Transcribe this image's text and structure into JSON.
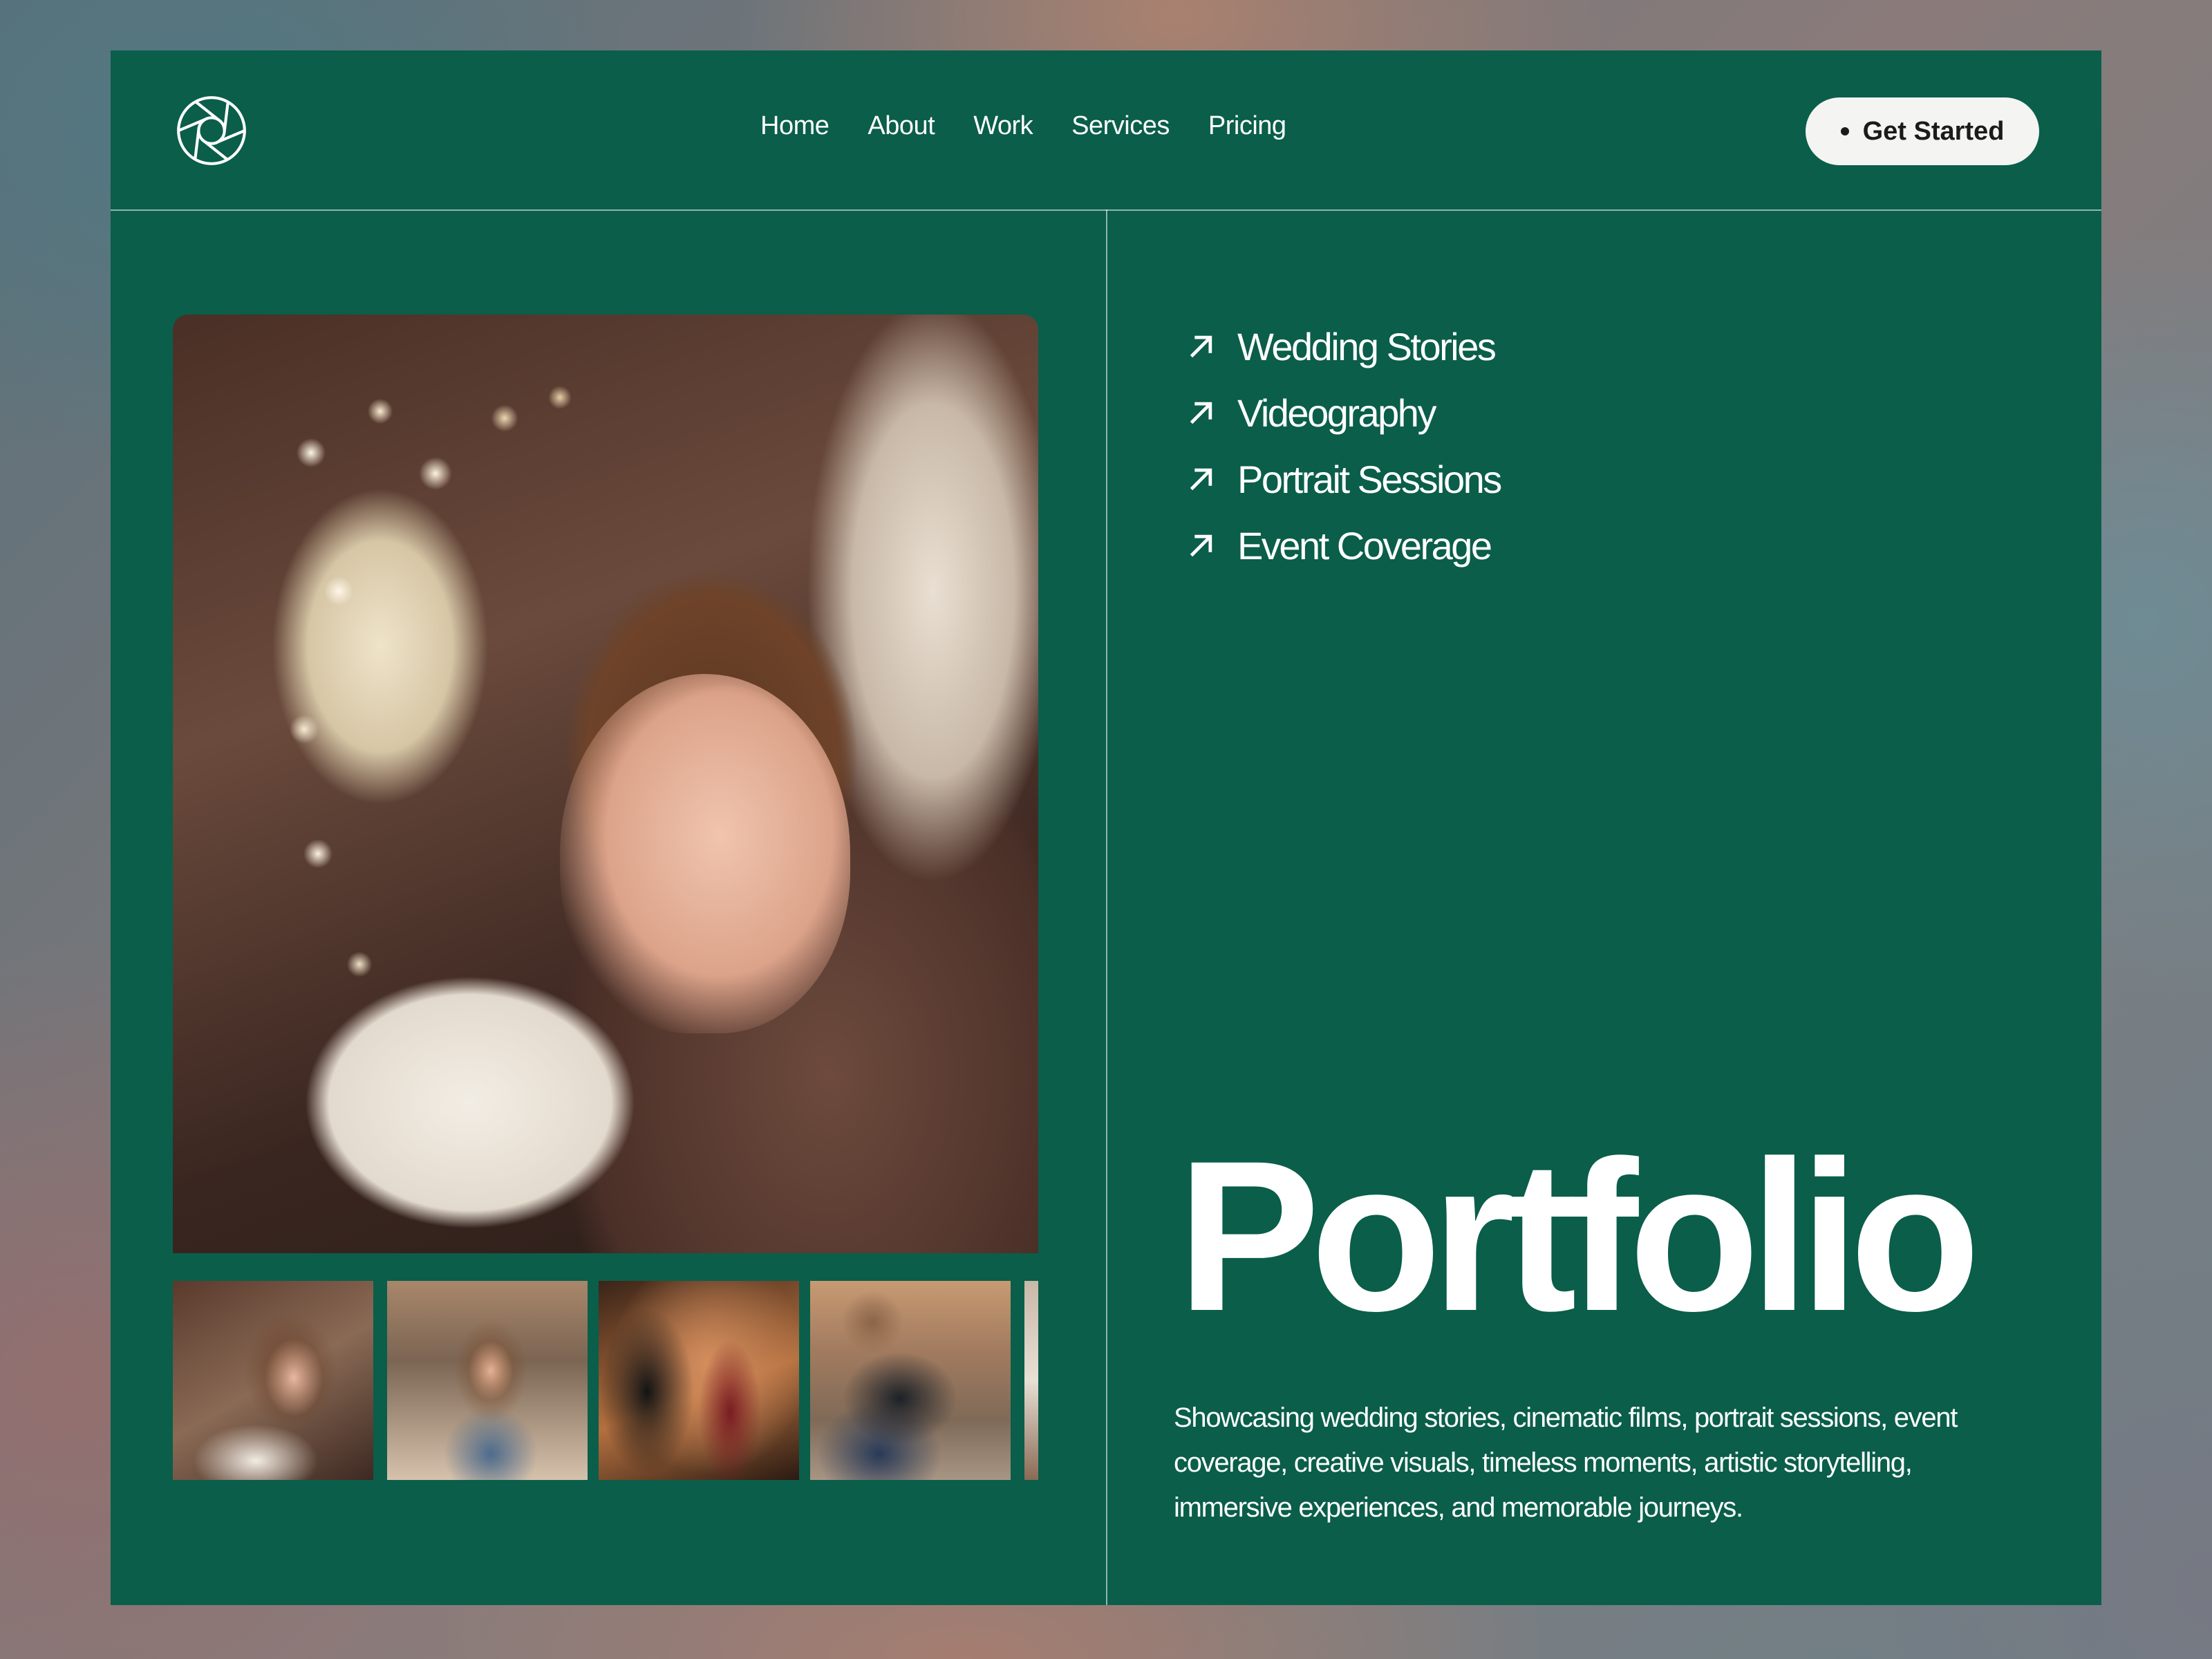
{
  "header": {
    "logo_icon": "camera-aperture-icon",
    "nav": [
      {
        "label": "Home"
      },
      {
        "label": "About"
      },
      {
        "label": "Work"
      },
      {
        "label": "Services"
      },
      {
        "label": "Pricing"
      }
    ],
    "cta_label": "Get Started"
  },
  "gallery": {
    "main_image": "bride-portrait-photo",
    "thumbnails": [
      {
        "image": "bride-portrait-thumbnail"
      },
      {
        "image": "woman-photographer-thumbnail"
      },
      {
        "image": "studio-shoot-thumbnail"
      },
      {
        "image": "cameraman-thumbnail"
      },
      {
        "image": "partial-thumbnail"
      }
    ]
  },
  "services": [
    {
      "label": "Wedding Stories",
      "icon": "arrow-up-right-icon"
    },
    {
      "label": "Videography",
      "icon": "arrow-up-right-icon"
    },
    {
      "label": "Portrait Sessions",
      "icon": "arrow-up-right-icon"
    },
    {
      "label": "Event Coverage",
      "icon": "arrow-up-right-icon"
    }
  ],
  "hero": {
    "title": "Portfolio",
    "description": "Showcasing wedding stories, cinematic films, portrait sessions, event coverage, creative visuals, timeless moments, artistic storytelling, immersive experiences, and memorable journeys."
  },
  "colors": {
    "card_background": "#0a5e4a",
    "text": "#ffffff",
    "cta_background": "#f4f4f2"
  }
}
